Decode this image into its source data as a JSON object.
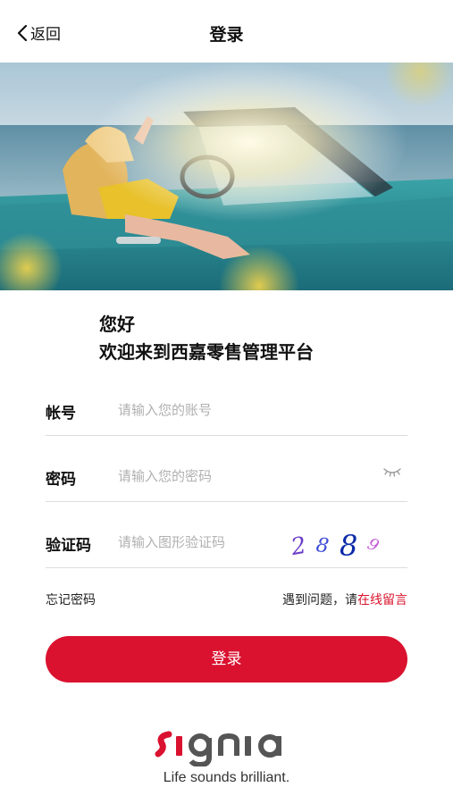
{
  "header": {
    "back_label": "返回",
    "title": "登录"
  },
  "hero": {
    "image": "woman-in-convertible-photo"
  },
  "greeting": {
    "hello": "您好",
    "welcome": "欢迎来到西嘉零售管理平台"
  },
  "form": {
    "account": {
      "label": "帐号",
      "placeholder": "请输入您的账号",
      "value": ""
    },
    "password": {
      "label": "密码",
      "placeholder": "请输入您的密码",
      "value": ""
    },
    "captcha": {
      "label": "验证码",
      "placeholder": "请输入图形验证码",
      "value": "",
      "code": [
        "2",
        "8",
        "8",
        "9"
      ]
    }
  },
  "links": {
    "forgot": "忘记密码",
    "help_prefix": "遇到问题，请",
    "online_message": "在线留言"
  },
  "login_button": "登录",
  "brand": {
    "logo": "signia",
    "tagline": "Life sounds brilliant."
  },
  "colors": {
    "accent": "#da1230",
    "divider": "#dddddd"
  }
}
